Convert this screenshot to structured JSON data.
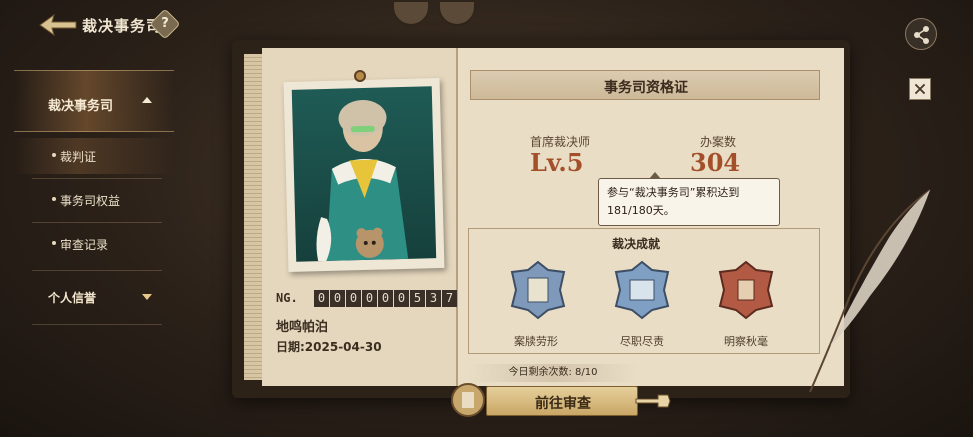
{
  "header": {
    "title": "裁决事务司",
    "help_label": "?"
  },
  "sidebar": {
    "group1": {
      "label": "裁决事务司",
      "expanded": true
    },
    "items": [
      {
        "label": "裁判证",
        "active": true
      },
      {
        "label": "事务司权益",
        "active": false
      },
      {
        "label": "审查记录",
        "active": false
      }
    ],
    "group2": {
      "label": "个人信誉",
      "expanded": false
    }
  },
  "profile": {
    "ng_label": "NG.",
    "ng_digits": [
      "0",
      "0",
      "0",
      "0",
      "0",
      "0",
      "5",
      "3",
      "7"
    ],
    "name": "地鸣帕泊",
    "date": "日期:2025-04-30"
  },
  "certificate": {
    "title": "事务司资格证",
    "rank_label": "首席裁决师",
    "rank_value": "Lv.5",
    "cases_label": "办案数",
    "cases_value": "304",
    "tooltip_line1": "参与“裁决事务司”累积达到",
    "tooltip_line2": "181/180天。",
    "achievements_title": "裁决成就",
    "achievements": [
      {
        "label": "案牍劳形",
        "icon": "book-scroll-badge-icon",
        "color": "#7f99ba"
      },
      {
        "label": "尽职尽责",
        "icon": "scale-badge-icon",
        "color": "#7fa0c2"
      },
      {
        "label": "明察秋毫",
        "icon": "red-shield-badge-icon",
        "color": "#b35a44"
      }
    ]
  },
  "footer": {
    "remaining_text": "今日剩余次数: 8/10",
    "go_button": "前往审查"
  },
  "colors": {
    "accent": "#a3502a",
    "paper": "#e9ddc5",
    "dark": "#2c2218"
  }
}
